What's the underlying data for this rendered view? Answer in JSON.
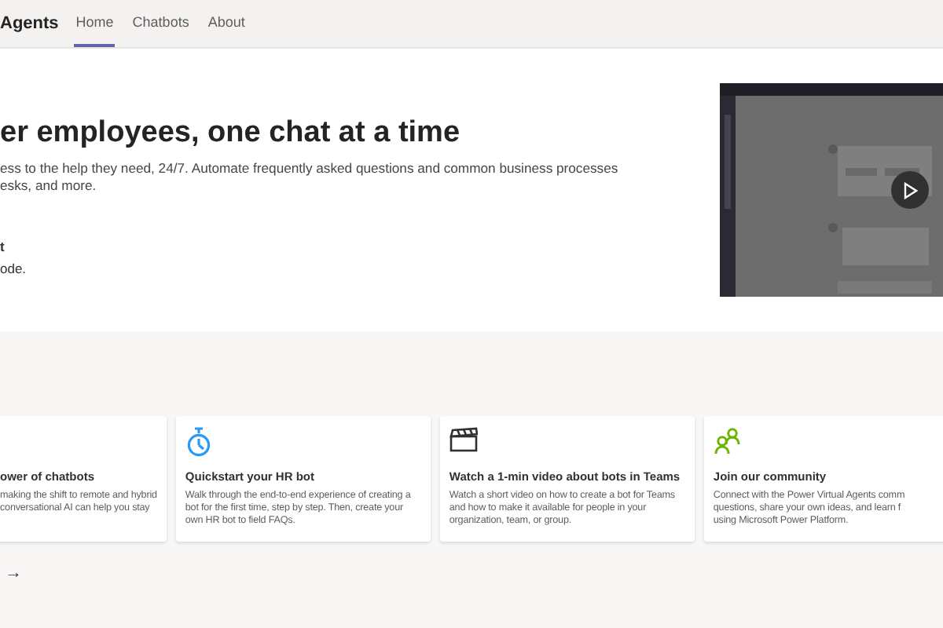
{
  "header": {
    "brand": "Agents",
    "tabs": [
      {
        "label": "Home",
        "selected": true
      },
      {
        "label": "Chatbots",
        "selected": false
      },
      {
        "label": "About",
        "selected": false
      }
    ]
  },
  "hero": {
    "headline": "er employees, one chat at a time",
    "intro_lines": [
      "ess to the help they need, 24/7. Automate frequently asked questions and common business processes",
      "esks, and more."
    ],
    "subheading": "t",
    "subtext": "ode.",
    "video": {
      "kind": "picture"
    }
  },
  "cards": [
    {
      "title": "ower of chatbots",
      "lines": [
        "making the shift to remote and hybrid",
        "conversational AI can help you stay"
      ]
    },
    {
      "title": "Quickstart your HR bot",
      "lines": [
        "Walk through the end-to-end experience of creating a",
        "bot for the first time, step by step. Then, create your",
        "own HR bot to field FAQs."
      ]
    },
    {
      "title": "Watch a 1-min video about bots in Teams",
      "lines": [
        "Watch a short video on how to create a bot for Teams",
        "and how to make it available for people in your",
        "organization, team, or group."
      ]
    },
    {
      "title": "Join our community",
      "lines": [
        "Connect with the Power Virtual Agents comm",
        "questions, share your own ideas, and learn f",
        "using Microsoft Power Platform."
      ]
    }
  ],
  "more_link": "→"
}
